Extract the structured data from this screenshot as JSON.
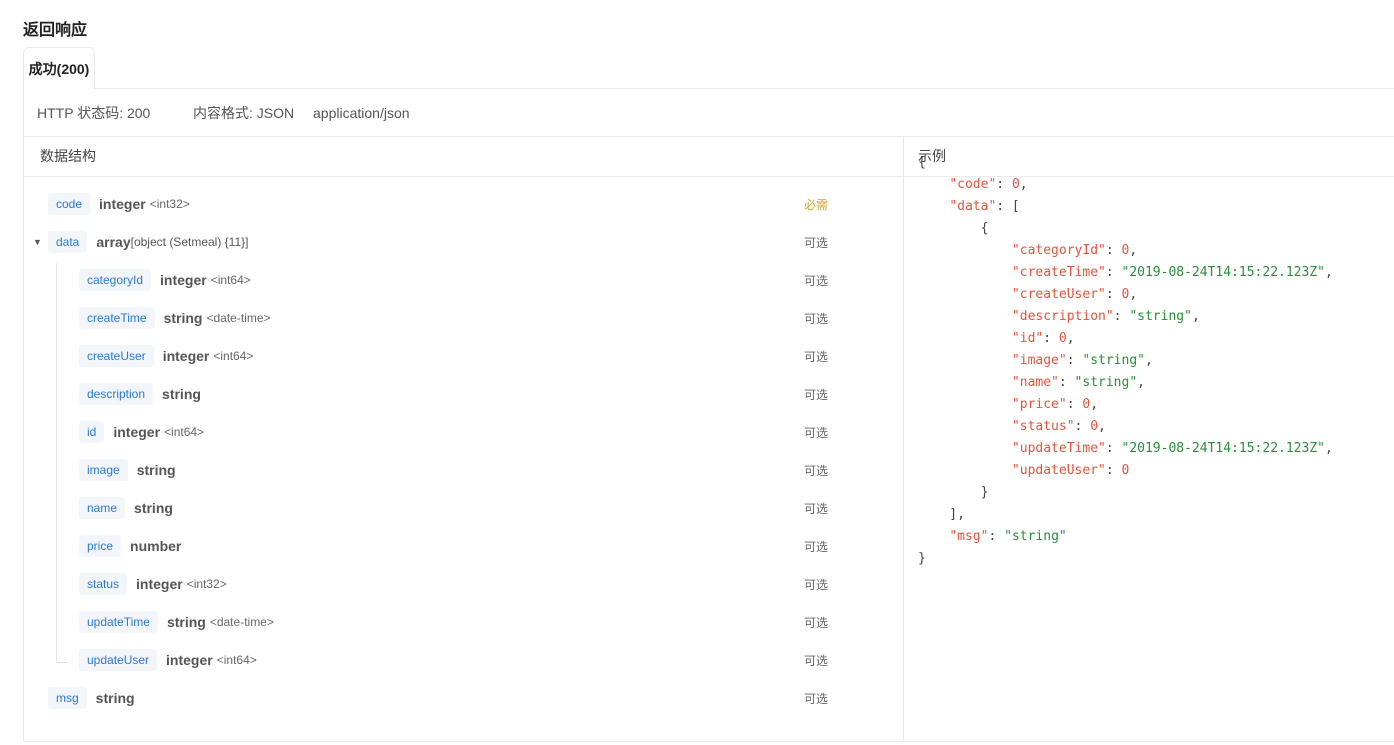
{
  "section_title": "返回响应",
  "tab": {
    "label": "成功(200)"
  },
  "meta": {
    "status": "HTTP 状态码: 200",
    "format": "内容格式: JSON",
    "content_type": "application/json"
  },
  "schema_header": "数据结构",
  "example_header": "示例",
  "labels": {
    "required": "必需",
    "optional": "可选"
  },
  "fields": {
    "code": {
      "name": "code",
      "type": "integer",
      "fmt": "<int32>",
      "req": "必需"
    },
    "data": {
      "name": "data",
      "type": "array",
      "fmt": "[object (Setmeal) {11}]",
      "req": "可选"
    },
    "categoryId": {
      "name": "categoryId",
      "type": "integer",
      "fmt": "<int64>",
      "req": "可选"
    },
    "createTime": {
      "name": "createTime",
      "type": "string",
      "fmt": "<date-time>",
      "req": "可选"
    },
    "createUser": {
      "name": "createUser",
      "type": "integer",
      "fmt": "<int64>",
      "req": "可选"
    },
    "description": {
      "name": "description",
      "type": "string",
      "fmt": "",
      "req": "可选"
    },
    "id": {
      "name": "id",
      "type": "integer",
      "fmt": "<int64>",
      "req": "可选"
    },
    "image": {
      "name": "image",
      "type": "string",
      "fmt": "",
      "req": "可选"
    },
    "name": {
      "name": "name",
      "type": "string",
      "fmt": "",
      "req": "可选"
    },
    "price": {
      "name": "price",
      "type": "number",
      "fmt": "",
      "req": "可选"
    },
    "status": {
      "name": "status",
      "type": "integer",
      "fmt": "<int32>",
      "req": "可选"
    },
    "updateTime": {
      "name": "updateTime",
      "type": "string",
      "fmt": "<date-time>",
      "req": "可选"
    },
    "updateUser": {
      "name": "updateUser",
      "type": "integer",
      "fmt": "<int64>",
      "req": "可选"
    },
    "msg": {
      "name": "msg",
      "type": "string",
      "fmt": "",
      "req": "可选"
    }
  },
  "example": {
    "code_key": "\"code\"",
    "code_val": "0",
    "data_key": "\"data\"",
    "categoryId_key": "\"categoryId\"",
    "categoryId_val": "0",
    "createTime_key": "\"createTime\"",
    "createTime_val": "\"2019-08-24T14:15:22.123Z\"",
    "createUser_key": "\"createUser\"",
    "createUser_val": "0",
    "description_key": "\"description\"",
    "description_val": "\"string\"",
    "id_key": "\"id\"",
    "id_val": "0",
    "image_key": "\"image\"",
    "image_val": "\"string\"",
    "name_key": "\"name\"",
    "name_val": "\"string\"",
    "price_key": "\"price\"",
    "price_val": "0",
    "status_key": "\"status\"",
    "status_val": "0",
    "updateTime_key": "\"updateTime\"",
    "updateTime_val": "\"2019-08-24T14:15:22.123Z\"",
    "updateUser_key": "\"updateUser\"",
    "updateUser_val": "0",
    "msg_key": "\"msg\"",
    "msg_val": "\"string\""
  },
  "colors": {
    "accent": "#2a78d4",
    "required": "#d9a230",
    "json_key": "#e2553d",
    "json_string": "#2a8d3a"
  }
}
